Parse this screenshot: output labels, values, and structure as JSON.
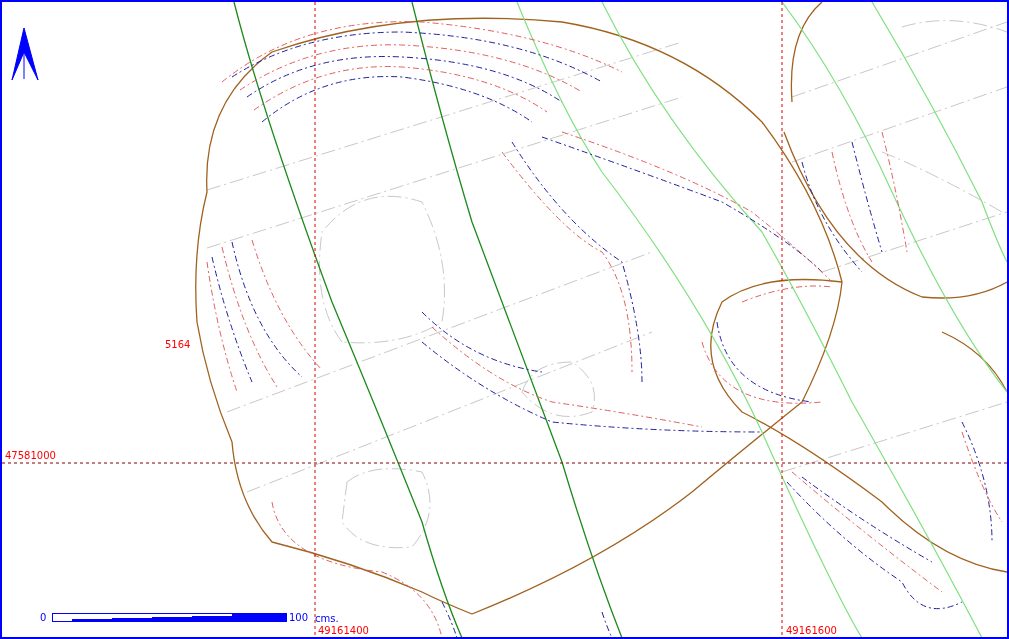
{
  "map": {
    "contour_label": "5164",
    "grid_lines": [
      {
        "kind": "horizontal",
        "label": "47581000"
      },
      {
        "kind": "vertical",
        "label": "49161400"
      },
      {
        "kind": "vertical",
        "label": "49161600"
      }
    ]
  },
  "scale_bar": {
    "start": "0",
    "end": "100",
    "unit": "cms."
  }
}
